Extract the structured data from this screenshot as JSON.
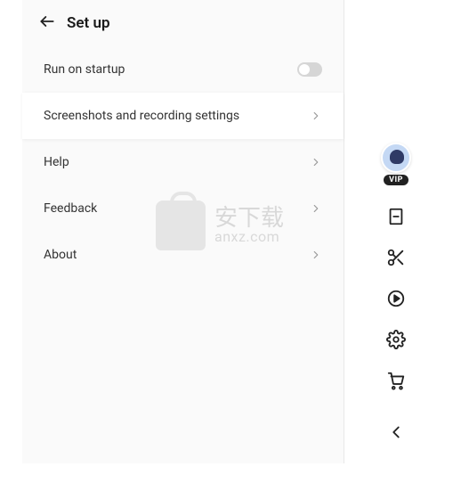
{
  "header": {
    "title": "Set up"
  },
  "settings": {
    "run_on_startup_label": "Run on startup",
    "screenshots_label": "Screenshots and recording settings",
    "help_label": "Help",
    "feedback_label": "Feedback",
    "about_label": "About"
  },
  "sidebar": {
    "vip_label": "VIP"
  },
  "watermark": {
    "cn": "安下载",
    "domain": "anxz.com"
  }
}
